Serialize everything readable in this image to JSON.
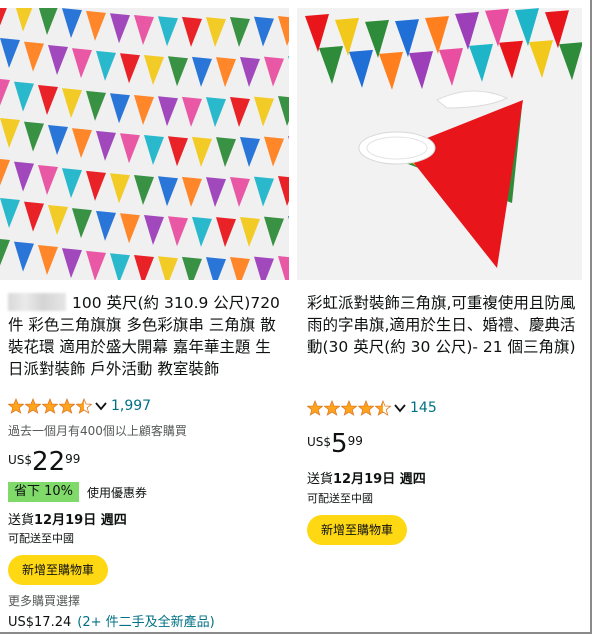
{
  "products": [
    {
      "title": "100 英尺(約 310.9 公尺)720 件 彩色三角旗旗 多色彩旗串 三角旗 散裝花環 適用於盛大開幕 嘉年華主題 生日派對裝飾 戶外活動 教室裝飾",
      "rating_value": 4.5,
      "rating_count": "1,997",
      "bought_text": "過去一個月有400個以上顧客購買",
      "price": {
        "currency": "US$",
        "whole": "22",
        "fraction": "99"
      },
      "coupon": {
        "badge": "省下 10%",
        "text": "使用優惠券"
      },
      "delivery": {
        "prefix": "送貨",
        "date": "12月19日 週四"
      },
      "ships_to": "可配送至中國",
      "add_to_cart": "新增至購物車",
      "more_choices": "更多購買選擇",
      "used_price": "US$17.24",
      "used_link": "(2+ 件二手及全新產品)"
    },
    {
      "title": "彩虹派對裝飾三角旗,可重複使用且防風雨的字串旗,適用於生日、婚禮、慶典活動(30 英尺(約 30 公尺)- 21 個三角旗)",
      "rating_value": 4.5,
      "rating_count": "145",
      "price": {
        "currency": "US$",
        "whole": "5",
        "fraction": "99"
      },
      "delivery": {
        "prefix": "送貨",
        "date": "12月19日 週四"
      },
      "ships_to": "可配送至中國",
      "add_to_cart": "新增至購物車"
    }
  ],
  "colors": {
    "star": "#ffa41c",
    "link": "#007185",
    "cart_button": "#ffd814",
    "coupon_badge": "#7fda69"
  }
}
